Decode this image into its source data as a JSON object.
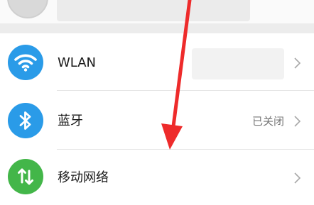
{
  "account": {
    "avatar_icon": "avatar-placeholder"
  },
  "settings": {
    "wlan": {
      "label": "WLAN",
      "icon": "wifi-icon",
      "icon_color": "#2a9be8"
    },
    "bluetooth": {
      "label": "蓝牙",
      "status": "已关闭",
      "icon": "bluetooth-icon",
      "icon_color": "#2a9be8"
    },
    "mobile_network": {
      "label": "移动网络",
      "icon": "mobile-data-icon",
      "icon_color": "#43b649"
    }
  },
  "annotation": {
    "arrow_color": "#ee2b2b"
  }
}
